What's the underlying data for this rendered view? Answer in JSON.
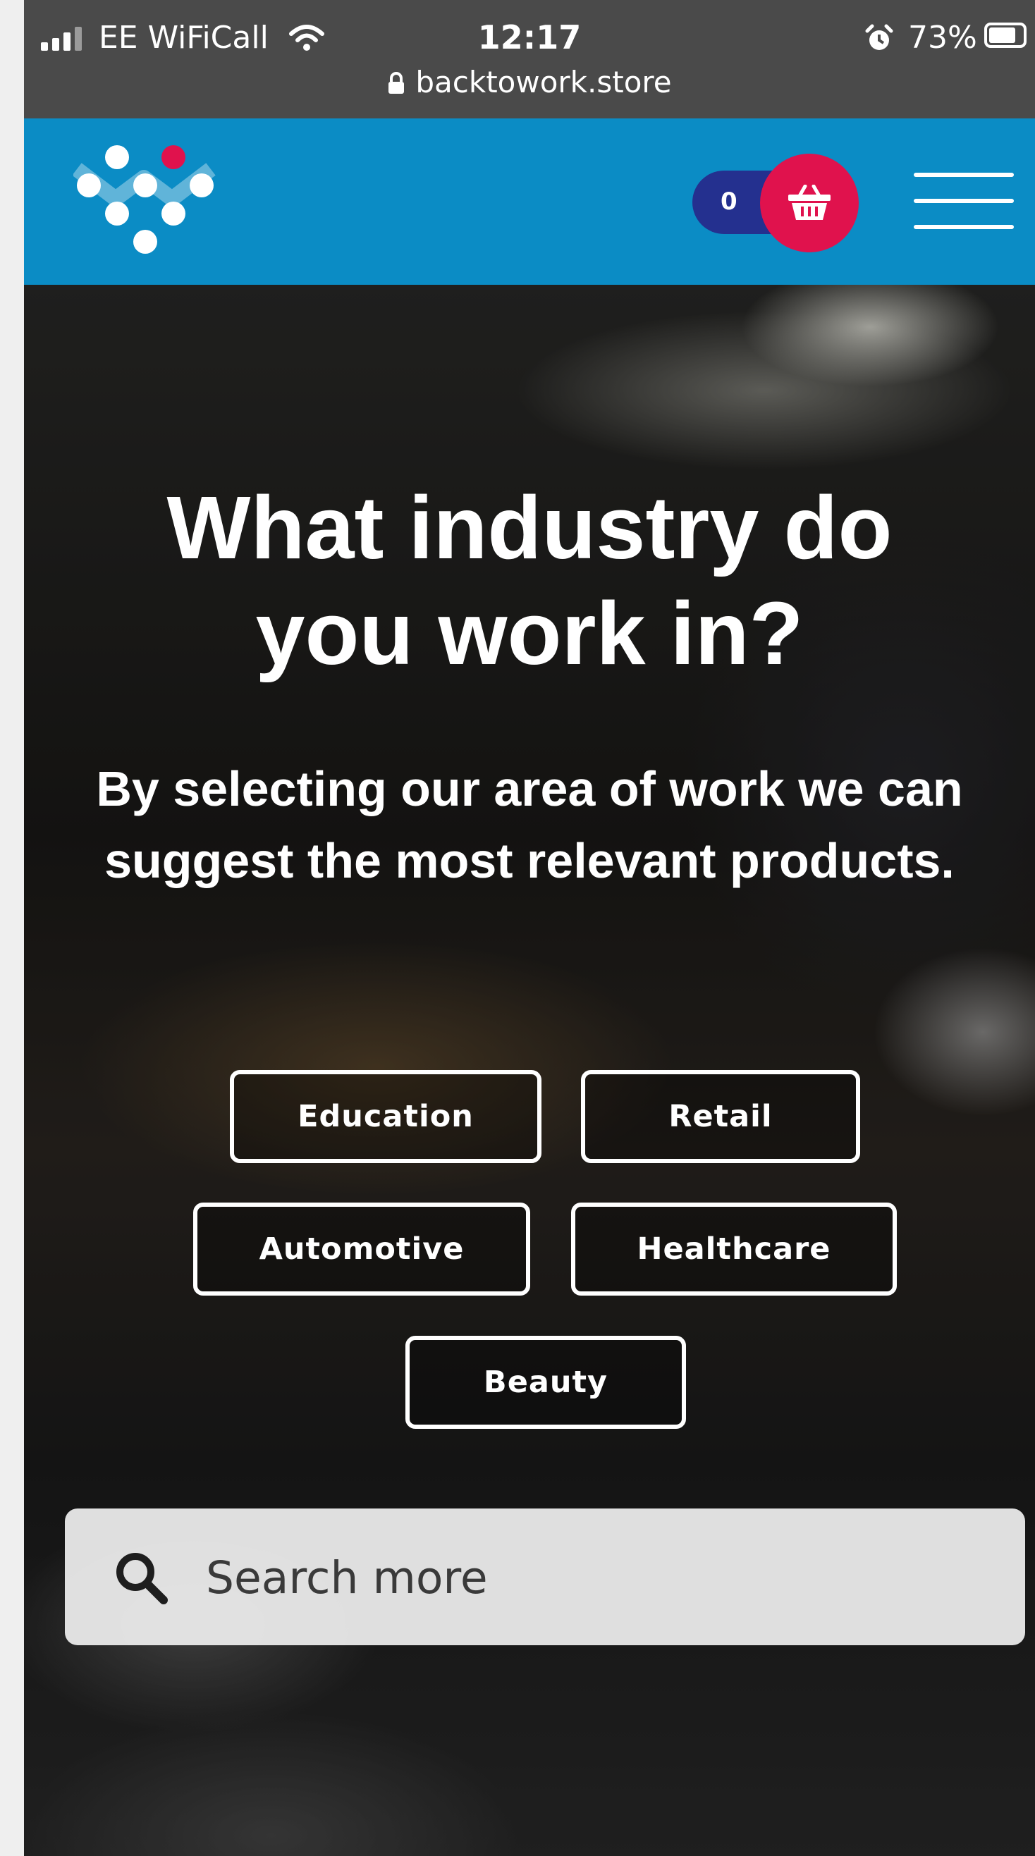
{
  "status_bar": {
    "carrier": "EE WiFiCall",
    "time": "12:17",
    "battery": "73%",
    "battery_level": 0.73,
    "url": "backtowork.store",
    "icons": [
      "signal-icon",
      "wifi-icon",
      "alarm-icon",
      "battery-icon",
      "lock-icon"
    ]
  },
  "header": {
    "background": "#0b8cc5",
    "cart_count": "0",
    "cart_pill_color": "#24308f",
    "basket_color": "#e0124d",
    "icons": [
      "logo-icon",
      "basket-icon",
      "hamburger-menu-icon"
    ]
  },
  "hero": {
    "title": "What industry do you work in?",
    "subtitle": "By selecting our area of work we can suggest the most relevant products.",
    "industries": [
      "Education",
      "Retail",
      "Automotive",
      "Healthcare",
      "Beauty"
    ],
    "search_placeholder": "Search more",
    "search_icon": "search-icon"
  }
}
